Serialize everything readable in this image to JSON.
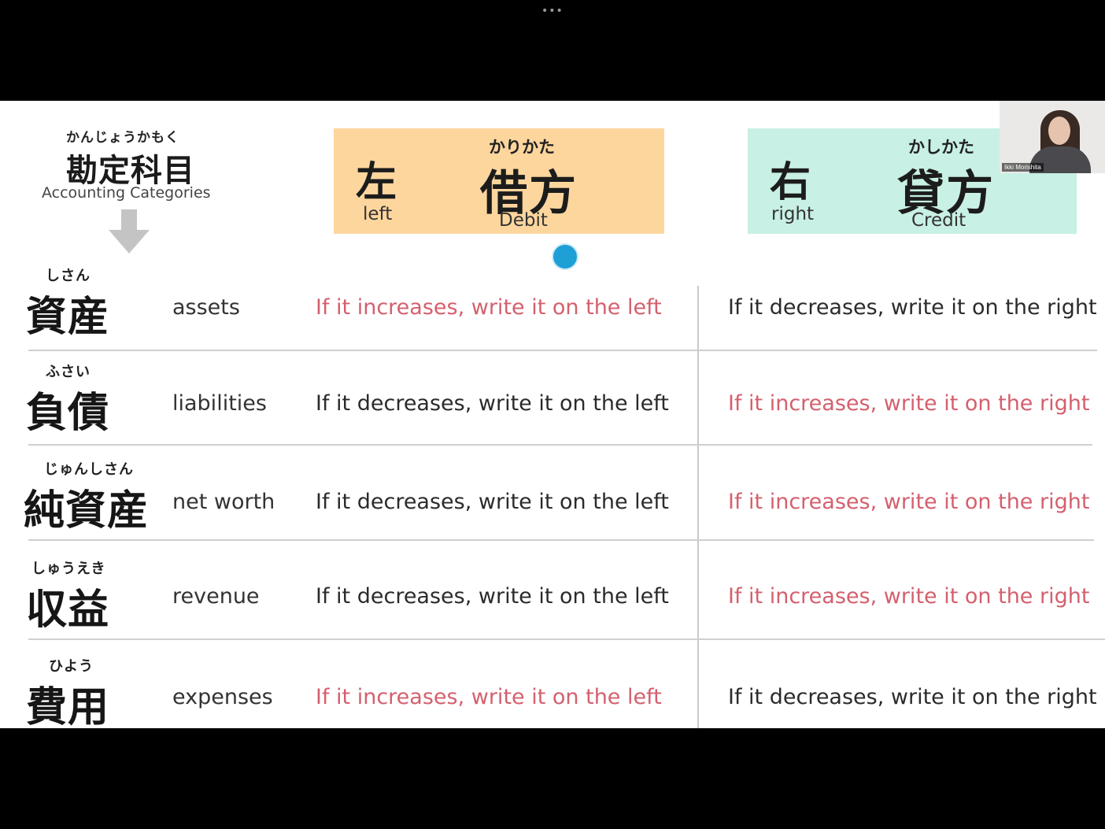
{
  "window": {
    "menu_dots": "•••"
  },
  "category_header": {
    "furigana": "かんじょうかもく",
    "kanji": "勘定科目",
    "english": "Accounting Categories"
  },
  "debit_header": {
    "side_kanji": "左",
    "side_english": "left",
    "furigana": "かりかた",
    "kanji": "借方",
    "english": "Debit",
    "bg_color": "#fdd69e"
  },
  "credit_header": {
    "side_kanji": "右",
    "side_english": "right",
    "furigana": "かしかた",
    "kanji": "貸方",
    "english": "Credit",
    "bg_color": "#c8f0e4"
  },
  "colors": {
    "increase_text": "#d4606e",
    "decrease_text": "#2b2b2b"
  },
  "rows": [
    {
      "furigana": "しさん",
      "kanji": "資産",
      "english": "assets",
      "debit_rule": "If it increases, write it on the left",
      "credit_rule": "If it decreases, write it on the right"
    },
    {
      "furigana": "ふさい",
      "kanji": "負債",
      "english": "liabilities",
      "debit_rule": "If it decreases, write it on the left",
      "credit_rule": "If it increases, write it on the right"
    },
    {
      "furigana": "じゅんしさん",
      "kanji": "純資産",
      "english": "net worth",
      "debit_rule": "If it decreases, write it on the left",
      "credit_rule": "If it increases, write it on the right"
    },
    {
      "furigana": "しゅうえき",
      "kanji": "収益",
      "english": "revenue",
      "debit_rule": "If it decreases, write it on the left",
      "credit_rule": "If it increases, write it on the right"
    },
    {
      "furigana": "ひよう",
      "kanji": "費用",
      "english": "expenses",
      "debit_rule": "If it increases, write it on the left",
      "credit_rule": "If it decreases, write it on the right"
    }
  ],
  "presenter": {
    "name": "Ikki Morishita"
  }
}
